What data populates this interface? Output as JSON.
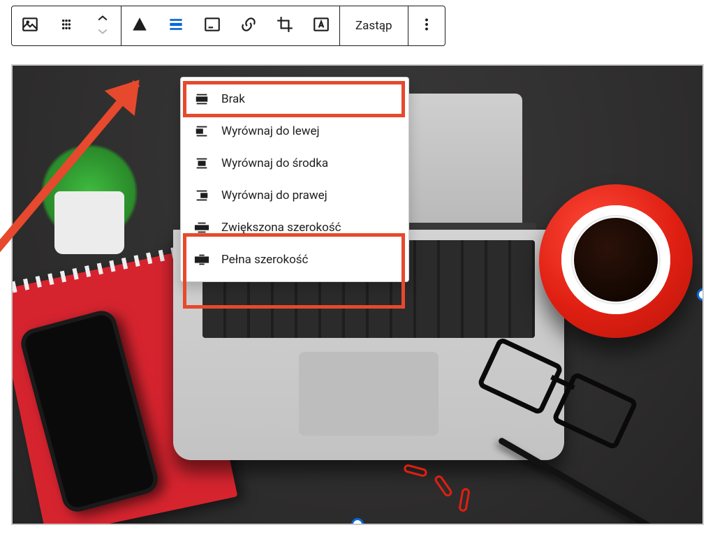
{
  "toolbar": {
    "replace_label": "Zastąp"
  },
  "dropdown": {
    "items": [
      {
        "label": "Brak"
      },
      {
        "label": "Wyrównaj do lewej"
      },
      {
        "label": "Wyrównaj do środka"
      },
      {
        "label": "Wyrównaj do prawej"
      },
      {
        "label": "Zwiększona szerokość"
      },
      {
        "label": "Pełna szerokość"
      }
    ]
  },
  "colors": {
    "active": "#0a68d6",
    "annotation": "#e6492d"
  }
}
